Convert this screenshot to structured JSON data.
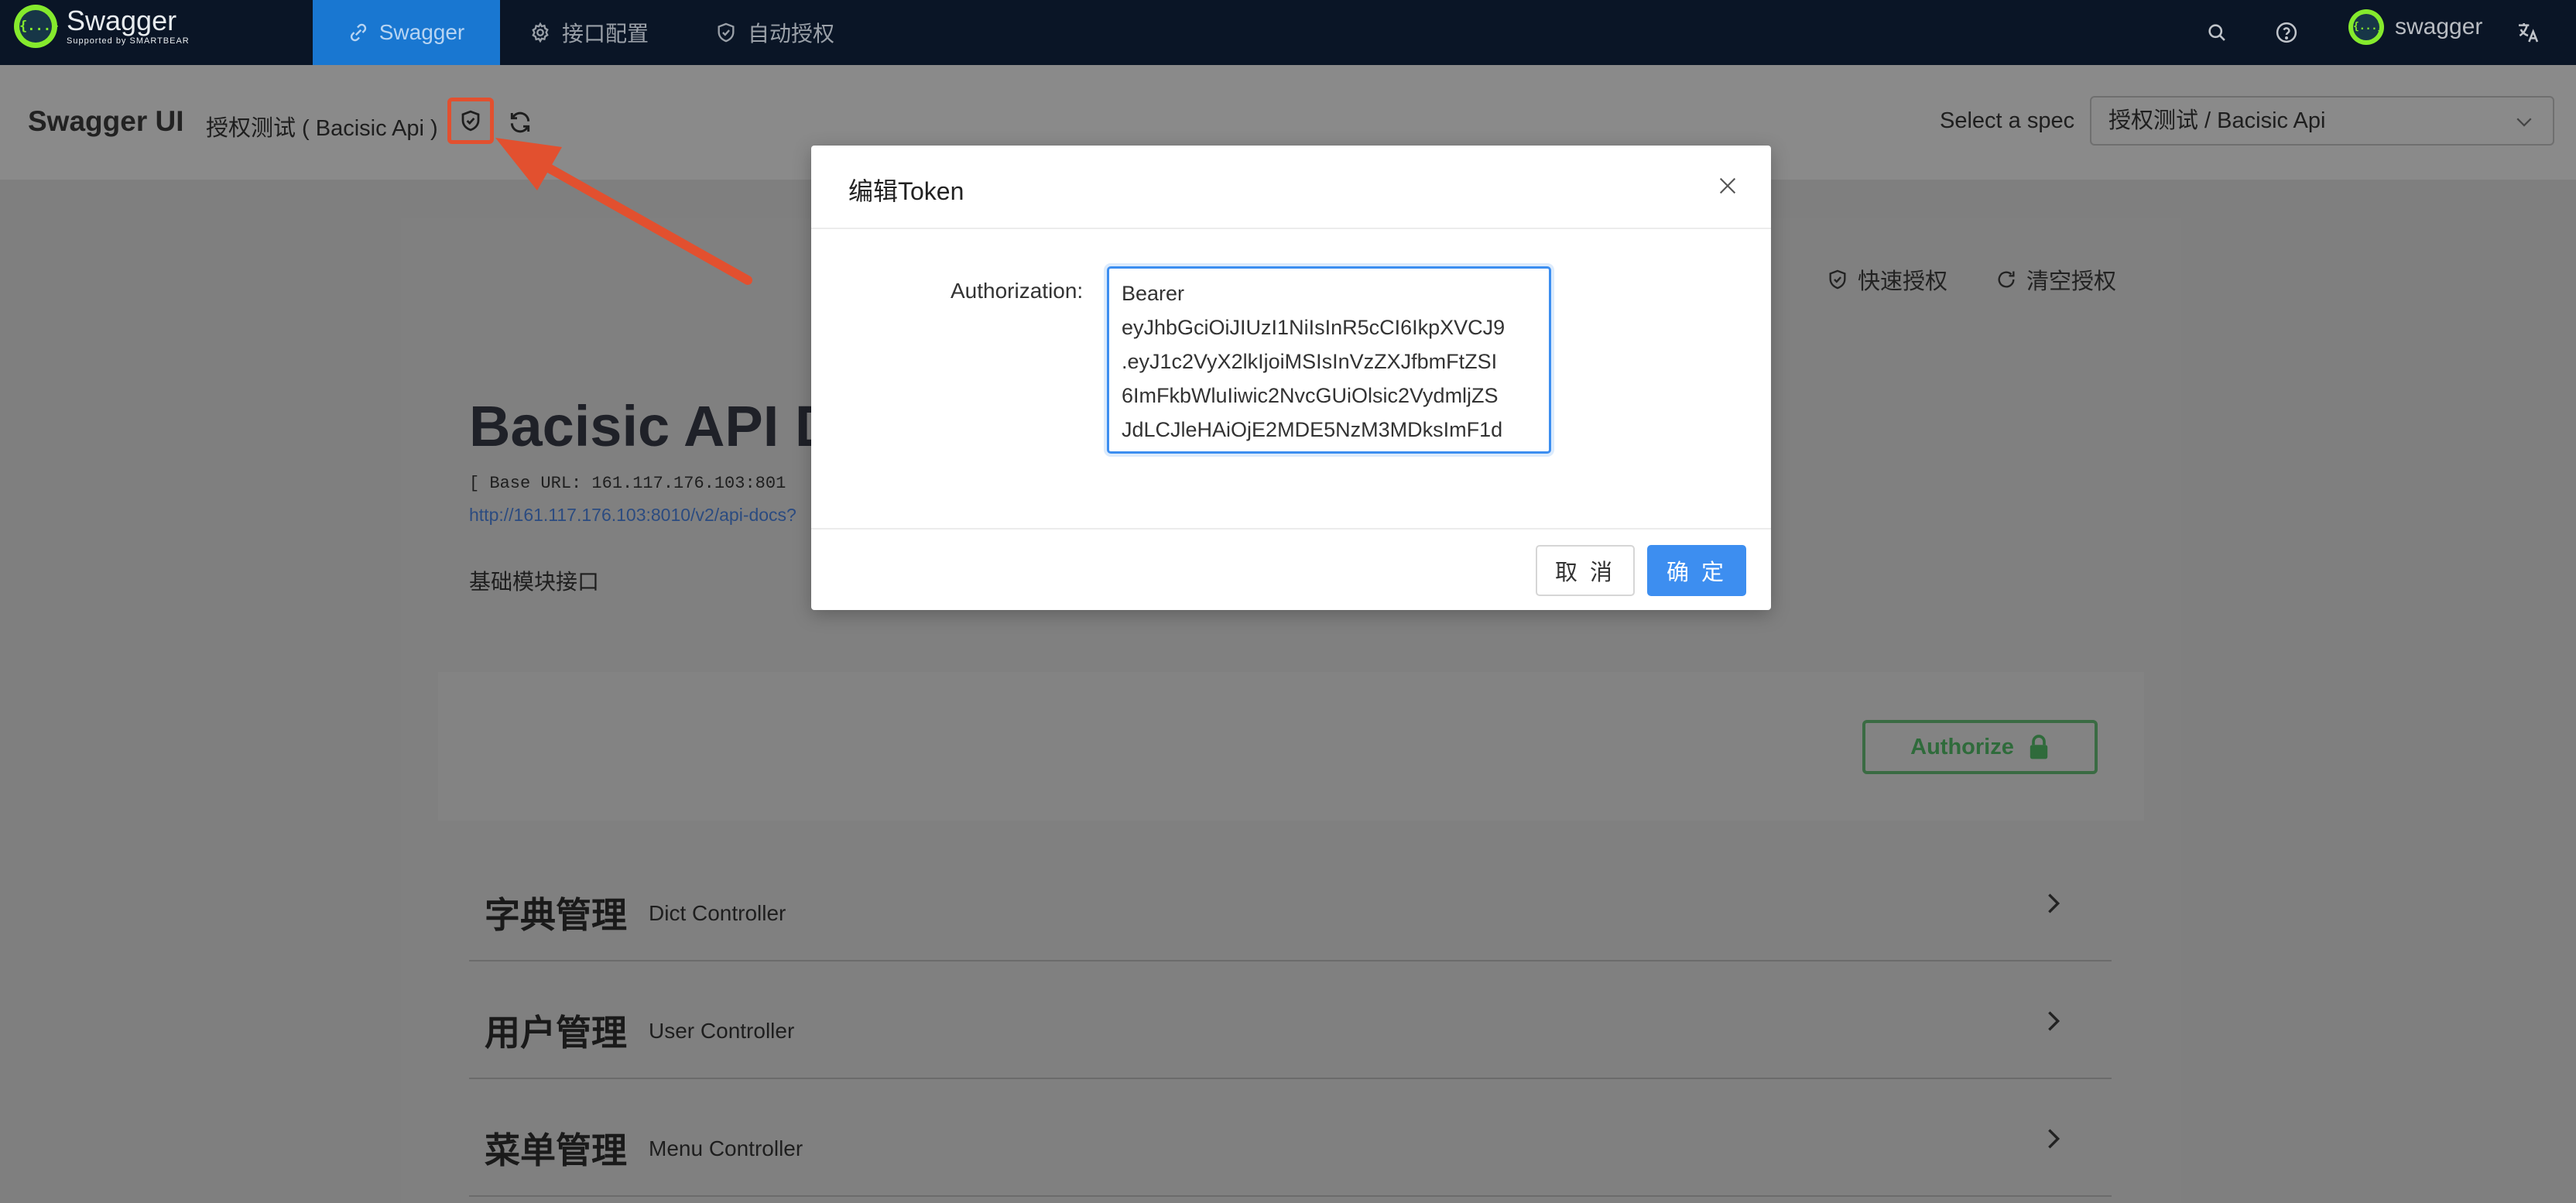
{
  "topnav": {
    "logo": {
      "badge": "{...}",
      "name": "Swagger",
      "tagline": "Supported by SMARTBEAR"
    },
    "tabs": [
      {
        "label": "Swagger",
        "icon": "link-icon",
        "active": true
      },
      {
        "label": "接口配置",
        "icon": "gear-icon",
        "active": false
      },
      {
        "label": "自动授权",
        "icon": "shield-icon",
        "active": false
      }
    ],
    "right_icons": [
      "search-icon",
      "help-icon",
      "translate-icon"
    ],
    "user": {
      "badge": "{...}",
      "name": "swagger"
    }
  },
  "subheader": {
    "title": "Swagger UI",
    "subtitle": "授权测试 ( Bacisic Api )",
    "spec_label": "Select a spec",
    "spec_value": "授权测试 / Bacisic Api"
  },
  "main": {
    "quick_auth": "快速授权",
    "clear_auth": "清空授权",
    "api_title": "Bacisic API D",
    "base_url": "[ Base URL: 161.117.176.103:801",
    "docs_link": "http://161.117.176.103:8010/v2/api-docs?",
    "description": "基础模块接口",
    "authorize_label": "Authorize",
    "sections": [
      {
        "zh": "字典管理",
        "en": "Dict Controller"
      },
      {
        "zh": "用户管理",
        "en": "User Controller"
      },
      {
        "zh": "菜单管理",
        "en": "Menu Controller"
      }
    ]
  },
  "modal": {
    "title": "编辑Token",
    "field_label": "Authorization:",
    "token_value": "Bearer\neyJhbGciOiJIUzI1NiIsInR5cCI6IkpXVCJ9\n.eyJ1c2VyX2lkIjoiMSIsInVzZXJfbmFtZSI\n6ImFkbWluIiwic2NvcGUiOlsic2VydmljZS\nJdLCJleHAiOjE2MDE5NzM3MDksImF1d",
    "cancel_label": "取 消",
    "ok_label": "确 定"
  },
  "colors": {
    "nav_bg": "#0a1526",
    "nav_active": "#1977d1",
    "primary": "#3d8ef0",
    "highlight": "#e2502f",
    "authorize_green": "#49cc90"
  }
}
